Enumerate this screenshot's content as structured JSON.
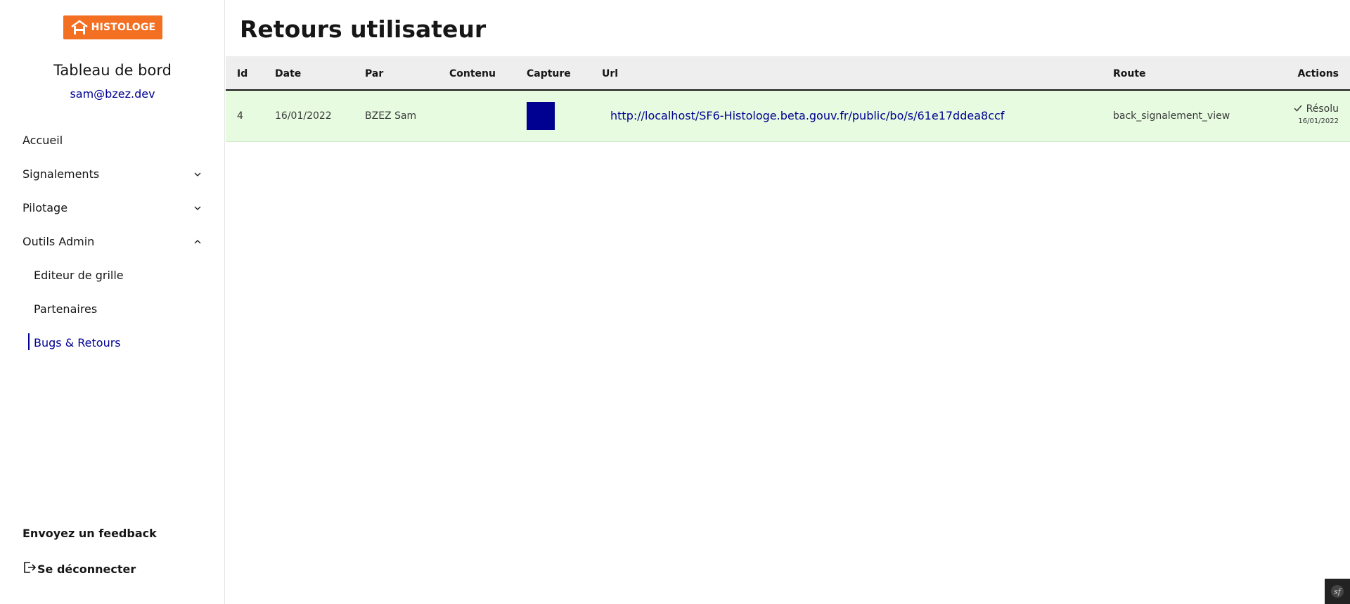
{
  "brand": {
    "logo_text": "HISTOLOGE",
    "logo_color": "#f36f21"
  },
  "sidebar": {
    "title": "Tableau de bord",
    "email": "sam@bzez.dev",
    "items": [
      {
        "label": "Accueil"
      },
      {
        "label": "Signalements",
        "expanded": false
      },
      {
        "label": "Pilotage",
        "expanded": false
      },
      {
        "label": "Outils Admin",
        "expanded": true
      }
    ],
    "sub_items": [
      {
        "label": "Editeur de grille"
      },
      {
        "label": "Partenaires"
      },
      {
        "label": "Bugs & Retours",
        "active": true
      }
    ],
    "feedback_label": "Envoyez un feedback",
    "logout_label": "Se déconnecter"
  },
  "main": {
    "title": "Retours utilisateur",
    "columns": [
      "Id",
      "Date",
      "Par",
      "Contenu",
      "Capture",
      "Url",
      "Route",
      "Actions"
    ],
    "rows": [
      {
        "id": "4",
        "date": "16/01/2022",
        "par": "BZEZ Sam",
        "contenu": "",
        "capture_color": "#000091",
        "url": "http://localhost/SF6-Histologe.beta.gouv.fr/public/bo/s/61e17ddea8ccf",
        "route": "back_signalement_view",
        "action_label": "Résolu",
        "action_date": "16/01/2022"
      }
    ]
  },
  "colors": {
    "accent": "#000091",
    "row_resolved": "#e6fbe0"
  }
}
